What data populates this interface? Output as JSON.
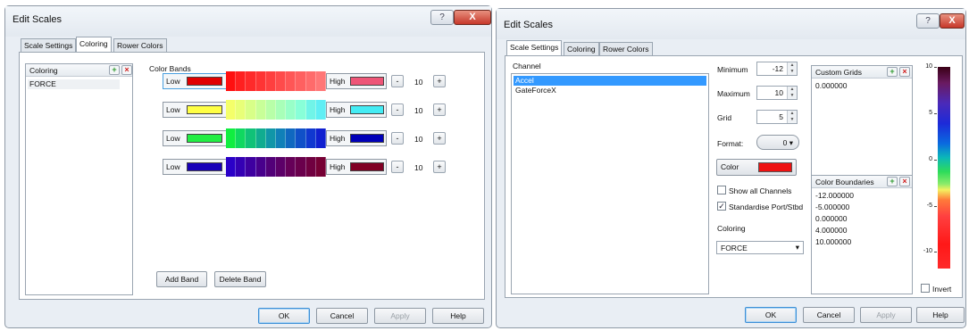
{
  "left_dialog": {
    "title": "Edit Scales",
    "help_symbol": "?",
    "close_symbol": "X",
    "tabs": [
      "Scale Settings",
      "Coloring",
      "Rower Colors"
    ],
    "coloring_header": "Coloring",
    "coloring_items": [
      "FORCE"
    ],
    "color_bands_label": "Color Bands",
    "bands": [
      {
        "low_label": "Low",
        "low_color": "#e10000",
        "high_label": "High",
        "high_color": "#ee5577",
        "value": "10",
        "grad": [
          "#ff1010",
          "#ff2020",
          "#ff2a2a",
          "#ff3434",
          "#ff3f3f",
          "#ff4b4b",
          "#ff5656",
          "#ff6060",
          "#ff6b6b",
          "#ff7777"
        ]
      },
      {
        "low_label": "Low",
        "low_color": "#ffff44",
        "high_label": "High",
        "high_color": "#44ecf4",
        "value": "10",
        "grad": [
          "#f4ff6a",
          "#e8ff78",
          "#d8ff88",
          "#c8ff98",
          "#b8ffa8",
          "#a8ffb8",
          "#98ffc8",
          "#88ffd8",
          "#70f4e8",
          "#60eef4"
        ]
      },
      {
        "low_label": "Low",
        "low_color": "#22ee44",
        "high_label": "High",
        "high_color": "#0000b8",
        "value": "10",
        "grad": [
          "#10ee40",
          "#10d860",
          "#10c278",
          "#10ac90",
          "#1096a8",
          "#1080b8",
          "#1068c0",
          "#1050c8",
          "#1038d0",
          "#1020d0"
        ]
      },
      {
        "low_label": "Low",
        "low_color": "#1800b8",
        "high_label": "High",
        "high_color": "#800024",
        "value": "10",
        "grad": [
          "#2a00c8",
          "#3400b4",
          "#3e00a0",
          "#48008c",
          "#520078",
          "#5c0068",
          "#660058",
          "#6a004c",
          "#700040",
          "#760034"
        ]
      }
    ],
    "minus_label": "-",
    "plus_label": "+",
    "add_band": "Add Band",
    "delete_band": "Delete Band",
    "ok": "OK",
    "cancel": "Cancel",
    "apply": "Apply",
    "help": "Help"
  },
  "right_dialog": {
    "title": "Edit Scales",
    "help_symbol": "?",
    "close_symbol": "X",
    "tabs": [
      "Scale Settings",
      "Coloring",
      "Rower Colors"
    ],
    "channel_label": "Channel",
    "channels": [
      "Accel",
      "GateForceX"
    ],
    "selected_channel": "Accel",
    "minimum_label": "Minimum",
    "minimum_value": "-12",
    "maximum_label": "Maximum",
    "maximum_value": "10",
    "grid_label": "Grid",
    "grid_value": "5",
    "format_label": "Format:",
    "format_value": "0",
    "color_button": "Color",
    "color_value": "#ee1111",
    "show_all_channels": "Show all Channels",
    "show_all_channels_checked": false,
    "standardise": "Standardise Port/Stbd",
    "standardise_checked": true,
    "coloring_label": "Coloring",
    "coloring_value": "FORCE",
    "custom_grids_header": "Custom Grids",
    "custom_grids": [
      "0.000000"
    ],
    "color_boundaries_header": "Color Boundaries",
    "color_boundaries": [
      "-12.000000",
      "-5.000000",
      "0.000000",
      "4.000000",
      "10.000000"
    ],
    "scale_ticks": [
      "10",
      "5",
      "0",
      "-5",
      "-10"
    ],
    "invert_label": "Invert",
    "invert_checked": false,
    "ok": "OK",
    "cancel": "Cancel",
    "apply": "Apply",
    "help": "Help"
  }
}
